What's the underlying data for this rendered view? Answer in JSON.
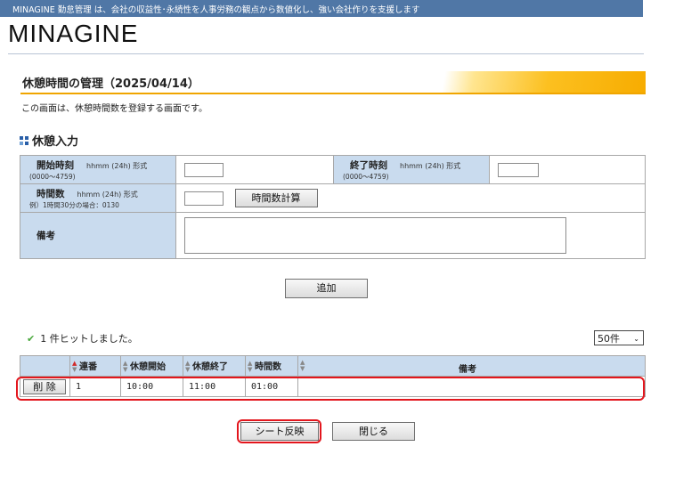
{
  "header": {
    "tagline": "MINAGINE 勤怠管理 は、会社の収益性･永続性を人事労務の観点から数値化し、強い会社作りを支援します",
    "logo_text": "MINAGINE"
  },
  "page": {
    "title": "休憩時間の管理（2025/04/14）",
    "description": "この画面は、休憩時間数を登録する画面です。"
  },
  "form": {
    "section_title": "休憩入力",
    "start_label": "開始時刻",
    "start_format": "hhmm (24h) 形式",
    "start_range": "(0000～4759)",
    "start_value": "",
    "end_label": "終了時刻",
    "end_format": "hhmm (24h) 形式",
    "end_range": "(0000～4759)",
    "end_value": "",
    "hours_label": "時間数",
    "hours_format": "hhmm (24h) 形式",
    "hours_example": "例）1時間30分の場合：0130",
    "hours_value": "",
    "calc_button": "時間数計算",
    "memo_label": "備考",
    "memo_value": "",
    "add_button": "追加"
  },
  "results": {
    "hit_text": "1 件ヒットしました。",
    "per_page": "50件",
    "per_page_arrow": "⌄",
    "columns": {
      "seq": "連番",
      "break_start": "休憩開始",
      "break_end": "休憩終了",
      "hours": "時間数",
      "memo": "備考"
    },
    "rows": [
      {
        "delete_label": "削 除",
        "seq": "1",
        "break_start": "10:00",
        "break_end": "11:00",
        "hours": "01:00",
        "memo": ""
      }
    ]
  },
  "footer": {
    "sheet_button": "シート反映",
    "close_button": "閉じる"
  },
  "colors": {
    "topbar": "#5077a6",
    "label_bg": "#c9dbee",
    "accent_orange": "#f0a500",
    "highlight_red": "#e3161d",
    "check_green": "#49a83c"
  },
  "icons": {
    "section_bullet": "grid-bullet-icon",
    "hit_check": "check-icon",
    "sort": "sort-arrows-icon"
  }
}
